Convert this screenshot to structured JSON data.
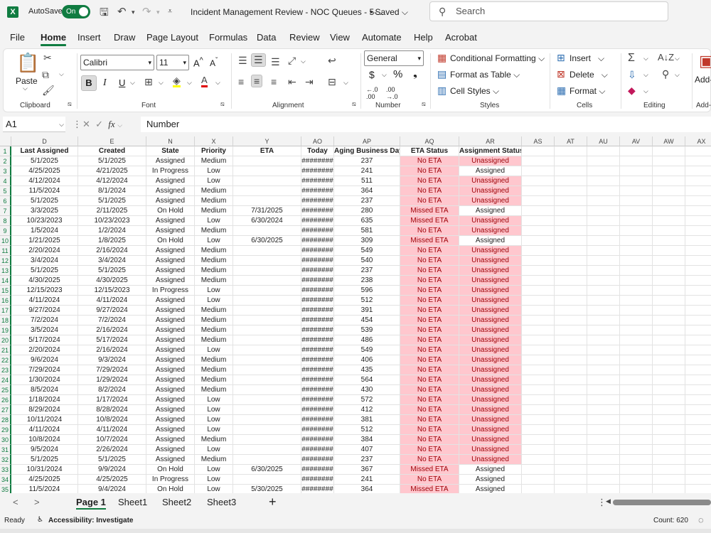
{
  "titlebar": {
    "app_logo": "X",
    "autosave_label": "AutoSave",
    "autosave_state": "On",
    "doc_title": "Incident Management Review - NOC Queues - 5-...",
    "saved_status": "• Saved",
    "search_placeholder": "Search"
  },
  "menu": [
    "File",
    "Home",
    "Insert",
    "Draw",
    "Page Layout",
    "Formulas",
    "Data",
    "Review",
    "View",
    "Automate",
    "Help",
    "Acrobat"
  ],
  "ribbon": {
    "clipboard": {
      "paste": "Paste",
      "label": "Clipboard"
    },
    "font": {
      "name": "Calibri",
      "size": "11",
      "bold": "B",
      "italic": "I",
      "underline": "U",
      "label": "Font"
    },
    "alignment": {
      "label": "Alignment"
    },
    "number": {
      "format": "General",
      "currency": "$",
      "percent": "%",
      "comma": "❟",
      "label": "Number"
    },
    "styles": {
      "conditional": "Conditional Formatting",
      "table": "Format as Table",
      "cell_styles": "Cell Styles",
      "label": "Styles"
    },
    "cells": {
      "insert": "Insert",
      "delete": "Delete",
      "format": "Format",
      "label": "Cells"
    },
    "editing": {
      "label": "Editing"
    },
    "addins": {
      "label": "Add-ins",
      "label_short": "Add-"
    }
  },
  "formula_bar": {
    "name_box": "A1",
    "fx": "fx",
    "content": "Number"
  },
  "columns": [
    "D",
    "E",
    "N",
    "X",
    "Y",
    "AO",
    "AP",
    "AQ",
    "AR",
    "AS",
    "AT",
    "AU",
    "AV",
    "AW",
    "AX"
  ],
  "headers": [
    "Last Assigned",
    "Created",
    "State",
    "Priority",
    "ETA",
    "Today",
    "Aging Business Days",
    "ETA Status",
    "Assignment Status"
  ],
  "rows": [
    [
      "5/1/2025",
      "5/1/2025",
      "Assigned",
      "Medium",
      "",
      "########",
      "237",
      "No ETA",
      "Unassigned"
    ],
    [
      "4/25/2025",
      "4/21/2025",
      "In Progress",
      "Low",
      "",
      "########",
      "241",
      "No ETA",
      "Assigned"
    ],
    [
      "4/12/2024",
      "4/12/2024",
      "Assigned",
      "Low",
      "",
      "########",
      "511",
      "No ETA",
      "Unassigned"
    ],
    [
      "11/5/2024",
      "8/1/2024",
      "Assigned",
      "Medium",
      "",
      "########",
      "364",
      "No ETA",
      "Unassigned"
    ],
    [
      "5/1/2025",
      "5/1/2025",
      "Assigned",
      "Medium",
      "",
      "########",
      "237",
      "No ETA",
      "Unassigned"
    ],
    [
      "3/3/2025",
      "2/11/2025",
      "On Hold",
      "Medium",
      "7/31/2025",
      "########",
      "280",
      "Missed ETA",
      "Assigned"
    ],
    [
      "10/23/2023",
      "10/23/2023",
      "Assigned",
      "Low",
      "6/30/2024",
      "########",
      "635",
      "Missed ETA",
      "Unassigned"
    ],
    [
      "1/5/2024",
      "1/2/2024",
      "Assigned",
      "Medium",
      "",
      "########",
      "581",
      "No ETA",
      "Unassigned"
    ],
    [
      "1/21/2025",
      "1/8/2025",
      "On Hold",
      "Low",
      "6/30/2025",
      "########",
      "309",
      "Missed ETA",
      "Assigned"
    ],
    [
      "2/20/2024",
      "2/16/2024",
      "Assigned",
      "Medium",
      "",
      "########",
      "549",
      "No ETA",
      "Unassigned"
    ],
    [
      "3/4/2024",
      "3/4/2024",
      "Assigned",
      "Medium",
      "",
      "########",
      "540",
      "No ETA",
      "Unassigned"
    ],
    [
      "5/1/2025",
      "5/1/2025",
      "Assigned",
      "Medium",
      "",
      "########",
      "237",
      "No ETA",
      "Unassigned"
    ],
    [
      "4/30/2025",
      "4/30/2025",
      "Assigned",
      "Medium",
      "",
      "########",
      "238",
      "No ETA",
      "Unassigned"
    ],
    [
      "12/15/2023",
      "12/15/2023",
      "In Progress",
      "Low",
      "",
      "########",
      "596",
      "No ETA",
      "Unassigned"
    ],
    [
      "4/11/2024",
      "4/11/2024",
      "Assigned",
      "Low",
      "",
      "########",
      "512",
      "No ETA",
      "Unassigned"
    ],
    [
      "9/27/2024",
      "9/27/2024",
      "Assigned",
      "Medium",
      "",
      "########",
      "391",
      "No ETA",
      "Unassigned"
    ],
    [
      "7/2/2024",
      "7/2/2024",
      "Assigned",
      "Medium",
      "",
      "########",
      "454",
      "No ETA",
      "Unassigned"
    ],
    [
      "3/5/2024",
      "2/16/2024",
      "Assigned",
      "Medium",
      "",
      "########",
      "539",
      "No ETA",
      "Unassigned"
    ],
    [
      "5/17/2024",
      "5/17/2024",
      "Assigned",
      "Medium",
      "",
      "########",
      "486",
      "No ETA",
      "Unassigned"
    ],
    [
      "2/20/2024",
      "2/16/2024",
      "Assigned",
      "Low",
      "",
      "########",
      "549",
      "No ETA",
      "Unassigned"
    ],
    [
      "9/6/2024",
      "9/3/2024",
      "Assigned",
      "Medium",
      "",
      "########",
      "406",
      "No ETA",
      "Unassigned"
    ],
    [
      "7/29/2024",
      "7/29/2024",
      "Assigned",
      "Medium",
      "",
      "########",
      "435",
      "No ETA",
      "Unassigned"
    ],
    [
      "1/30/2024",
      "1/29/2024",
      "Assigned",
      "Medium",
      "",
      "########",
      "564",
      "No ETA",
      "Unassigned"
    ],
    [
      "8/5/2024",
      "8/2/2024",
      "Assigned",
      "Medium",
      "",
      "########",
      "430",
      "No ETA",
      "Unassigned"
    ],
    [
      "1/18/2024",
      "1/17/2024",
      "Assigned",
      "Low",
      "",
      "########",
      "572",
      "No ETA",
      "Unassigned"
    ],
    [
      "8/29/2024",
      "8/28/2024",
      "Assigned",
      "Low",
      "",
      "########",
      "412",
      "No ETA",
      "Unassigned"
    ],
    [
      "10/11/2024",
      "10/8/2024",
      "Assigned",
      "Low",
      "",
      "########",
      "381",
      "No ETA",
      "Unassigned"
    ],
    [
      "4/11/2024",
      "4/11/2024",
      "Assigned",
      "Low",
      "",
      "########",
      "512",
      "No ETA",
      "Unassigned"
    ],
    [
      "10/8/2024",
      "10/7/2024",
      "Assigned",
      "Medium",
      "",
      "########",
      "384",
      "No ETA",
      "Unassigned"
    ],
    [
      "9/5/2024",
      "2/26/2024",
      "Assigned",
      "Low",
      "",
      "########",
      "407",
      "No ETA",
      "Unassigned"
    ],
    [
      "5/1/2025",
      "5/1/2025",
      "Assigned",
      "Medium",
      "",
      "########",
      "237",
      "No ETA",
      "Unassigned"
    ],
    [
      "10/31/2024",
      "9/9/2024",
      "On Hold",
      "Low",
      "6/30/2025",
      "########",
      "367",
      "Missed ETA",
      "Assigned"
    ],
    [
      "4/25/2025",
      "4/25/2025",
      "In Progress",
      "Low",
      "",
      "########",
      "241",
      "No ETA",
      "Assigned"
    ],
    [
      "11/5/2024",
      "9/4/2024",
      "On Hold",
      "Low",
      "5/30/2025",
      "########",
      "364",
      "Missed ETA",
      "Assigned"
    ]
  ],
  "sheets": [
    "Page 1",
    "Sheet1",
    "Sheet2",
    "Sheet3"
  ],
  "active_sheet": "Page 1",
  "status": {
    "ready": "Ready",
    "accessibility": "Accessibility: Investigate",
    "count": "Count: 620"
  },
  "colors": {
    "accent": "#107c41",
    "bad_fill": "#ffc7ce",
    "bad_text": "#9c0006"
  }
}
